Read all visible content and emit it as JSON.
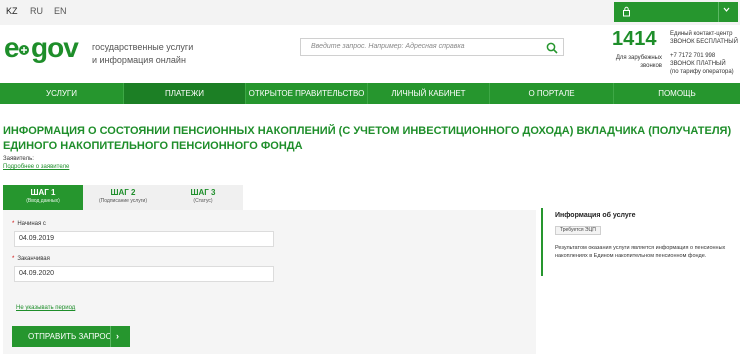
{
  "languages": [
    "KZ",
    "RU",
    "EN"
  ],
  "header": {
    "logo_text": "egov",
    "tagline_line1": "государственные услуги",
    "tagline_line2": "и информация онлайн",
    "search_placeholder": "Введите запрос. Например: Адресная справка",
    "contact_number": "1414",
    "contact_desc_line1": "Единый контакт-центр",
    "contact_desc_line2": "ЗВОНОК БЕСПЛАТНЫЙ",
    "abroad_line1": "Для зарубежных",
    "abroad_line2": "звонков",
    "abroad_number": "+7 7172 701 998",
    "abroad_desc1": "ЗВОНОК ПЛАТНЫЙ",
    "abroad_desc2": "(по тарифу оператора)"
  },
  "nav": [
    {
      "label": "УСЛУГИ",
      "active": false
    },
    {
      "label": "ПЛАТЕЖИ",
      "active": true
    },
    {
      "label": "ОТКРЫТОЕ ПРАВИТЕЛЬСТВО",
      "active": false
    },
    {
      "label": "ЛИЧНЫЙ КАБИНЕТ",
      "active": false
    },
    {
      "label": "О ПОРТАЛЕ",
      "active": false
    },
    {
      "label": "ПОМОЩЬ",
      "active": false
    }
  ],
  "page": {
    "title": "ИНФОРМАЦИЯ О СОСТОЯНИИ ПЕНСИОННЫХ НАКОПЛЕНИЙ (С УЧЕТОМ ИНВЕСТИЦИОННОГО ДОХОДА) ВКЛАДЧИКА (ПОЛУЧАТЕЛЯ) ЕДИНОГО НАКОПИТЕЛЬНОГО ПЕНСИОННОГО ФОНДА",
    "applicant_label": "Заявитель:",
    "applicant_link": "Подробнее о заявителе"
  },
  "steps": [
    {
      "title": "ШАГ 1",
      "sub": "(Ввод данных)",
      "active": true
    },
    {
      "title": "ШАГ 2",
      "sub": "(Подписание услуги)",
      "active": false
    },
    {
      "title": "ШАГ 3",
      "sub": "(Статус)",
      "active": false
    }
  ],
  "form": {
    "start_label": "Начиная с",
    "start_value": "04.09.2019",
    "end_label": "Заканчивая",
    "end_value": "04.09.2020",
    "no_period_link": "Не указывать период",
    "submit_label": "ОТПРАВИТЬ ЗАПРОС",
    "required_mark": "*",
    "submit_arrow": "›"
  },
  "info": {
    "title": "Информация об услуге",
    "badge": "Требуется ЭЦП",
    "description": "Результатом оказания услуги является информация о пенсионных накоплениях в Едином накопительном пенсионном фонде."
  },
  "colors": {
    "brand_green": "#26962e",
    "brand_green_dark": "#1c7f25"
  }
}
